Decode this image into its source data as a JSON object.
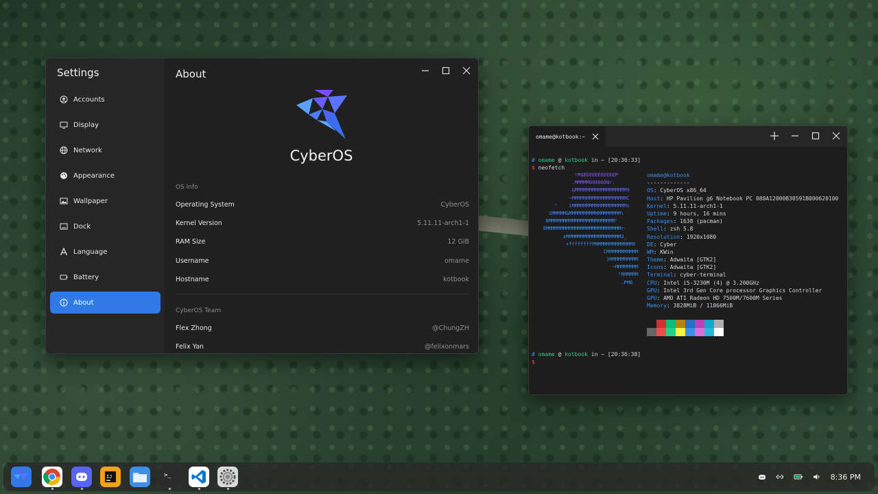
{
  "settings": {
    "title": "Settings",
    "page_title": "About",
    "sidebar": [
      {
        "label": "Accounts",
        "icon": "account-icon"
      },
      {
        "label": "Display",
        "icon": "display-icon"
      },
      {
        "label": "Network",
        "icon": "globe-icon"
      },
      {
        "label": "Appearance",
        "icon": "palette-icon"
      },
      {
        "label": "Wallpaper",
        "icon": "image-icon"
      },
      {
        "label": "Dock",
        "icon": "dock-icon"
      },
      {
        "label": "Language",
        "icon": "language-icon"
      },
      {
        "label": "Battery",
        "icon": "battery-icon"
      },
      {
        "label": "About",
        "icon": "info-icon",
        "active": true
      }
    ],
    "brand": "CyberOS",
    "os_info_header": "OS Info",
    "os_info": [
      {
        "key": "Operating System",
        "value": "CyberOS"
      },
      {
        "key": "Kernel Version",
        "value": "5.11.11-arch1-1"
      },
      {
        "key": "RAM Size",
        "value": "12 GiB"
      },
      {
        "key": "Username",
        "value": "omame"
      },
      {
        "key": "Hostname",
        "value": "kotbook"
      }
    ],
    "team_header": "CyberOS Team",
    "team": [
      {
        "name": "Flex Zhong",
        "handle": "@ChungZH"
      },
      {
        "name": "Felix Yan",
        "handle": "@felixonmars"
      }
    ]
  },
  "terminal": {
    "tab_title": "omame@kotbook:~",
    "prompt1": {
      "hash": "#",
      "user": "omame",
      "at": "@",
      "host": "kotbook",
      "in": "in",
      "dir": "~",
      "time": "[20:36:33]"
    },
    "command": "neofetch",
    "prompt2": {
      "hash": "#",
      "user": "omame",
      "at": "@",
      "host": "kotbook",
      "in": "in",
      "dir": "~",
      "time": "[20:36:38]"
    },
    "dollar": "$",
    "ascii_art": [
      "             !M$EEEEEEEEEEEP",
      "            .MMMMM000000Nr.",
      "            &MMMMMMMMMMMMMMMMMM9",
      "           ~MMMMMMMMMMMMMMMMMMMC",
      "      \"    iMMMMMMMMMMMMMMMMMMMs",
      "    iMMMMM&MMMMMMMMMMMMMMMMMM\\",
      "   BMMMMMMMMMMMMMMMMMMMMMMM'",
      "  9MMMMMMMMMMMMMMMMMMMMMMMMMMr-",
      "         sMMMMMMMMMMMMMMMMMMM3_",
      "          +ffffffffPMMMMMMMMMMMMM0",
      "                       CMMMMMMMMMMM",
      "                        }MMMMMMMMMM",
      "                          ~MMMMMMMM",
      "                            \"RMMMMM",
      "                             .PMB"
    ],
    "user_host": "omame@kotbook",
    "separator": "-------------",
    "info": [
      {
        "key": "OS",
        "value": "CyberOS x86_64"
      },
      {
        "key": "Host",
        "value": "HP Pavilion g6 Notebook PC 088A12000B30591B000620100"
      },
      {
        "key": "Kernel",
        "value": "5.11.11-arch1-1"
      },
      {
        "key": "Uptime",
        "value": "9 hours, 16 mins"
      },
      {
        "key": "Packages",
        "value": "1638 (pacman)"
      },
      {
        "key": "Shell",
        "value": "zsh 5.8"
      },
      {
        "key": "Resolution",
        "value": "1920x1080"
      },
      {
        "key": "DE",
        "value": "Cyber"
      },
      {
        "key": "WM",
        "value": "KWin"
      },
      {
        "key": "Theme",
        "value": "Adwaita [GTK2]"
      },
      {
        "key": "Icons",
        "value": "Adwaita [GTK2]"
      },
      {
        "key": "Terminal",
        "value": "cyber-terminal"
      },
      {
        "key": "CPU",
        "value": "Intel i5-3230M (4) @ 3.200GHz"
      },
      {
        "key": "GPU",
        "value": "Intel 3rd Gen Core processor Graphics Controller"
      },
      {
        "key": "GPU",
        "value": "AMD ATI Radeon HD 7500M/7600M Series"
      },
      {
        "key": "Memory",
        "value": "3828MiB / 11866MiB"
      }
    ],
    "palette_row1": [
      "#1d1d1d",
      "#cd3131",
      "#0dbc79",
      "#b5830f",
      "#2472c8",
      "#bc3fbc",
      "#11a8cd",
      "#b0b0b0"
    ],
    "palette_row2": [
      "#666666",
      "#f14c4c",
      "#23d18b",
      "#f5f543",
      "#3b8eea",
      "#d670d6",
      "#29b8db",
      "#ffffff"
    ]
  },
  "dock": {
    "apps": [
      {
        "name": "launcher",
        "color": "#2f7ae5",
        "icon": "launcher-icon"
      },
      {
        "name": "chrome",
        "color": "#ffffff",
        "icon": "chrome-icon"
      },
      {
        "name": "discord",
        "color": "#5865f2",
        "icon": "discord-icon"
      },
      {
        "name": "intellij",
        "color": "#f0a21c",
        "icon": "intellij-icon"
      },
      {
        "name": "files",
        "color": "#3d8fe6",
        "icon": "folder-icon"
      },
      {
        "name": "terminal",
        "color": "#2b2b2b",
        "icon": "terminal-icon"
      },
      {
        "name": "vscode",
        "color": "#ffffff",
        "icon": "vscode-icon"
      },
      {
        "name": "settings",
        "color": "#d9d9d9",
        "icon": "gear-icon"
      }
    ],
    "clock": "8:36 PM"
  }
}
